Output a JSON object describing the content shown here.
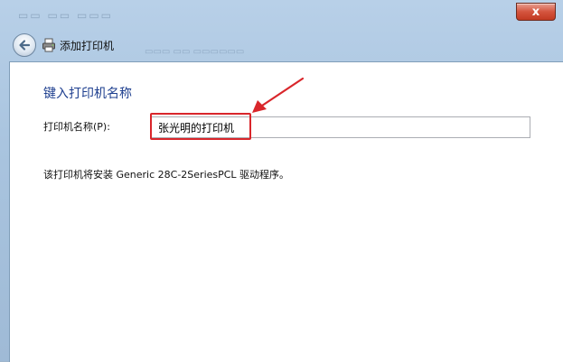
{
  "window": {
    "close_label": "x",
    "nav_title": "添加打印机"
  },
  "icons": {
    "back": "back-arrow-icon",
    "printer": "printer-icon",
    "close": "close-icon",
    "annotation": "red-arrow-icon"
  },
  "page": {
    "heading": "键入打印机名称",
    "printer_name_label": "打印机名称(P):",
    "printer_name_value": "张光明的打印机",
    "driver_info": "该打印机将安装 Generic 28C-2SeriesPCL 驱动程序。"
  },
  "colors": {
    "heading": "#1e3f8f",
    "highlight": "#d9262b",
    "close_button": "#c23a22"
  }
}
